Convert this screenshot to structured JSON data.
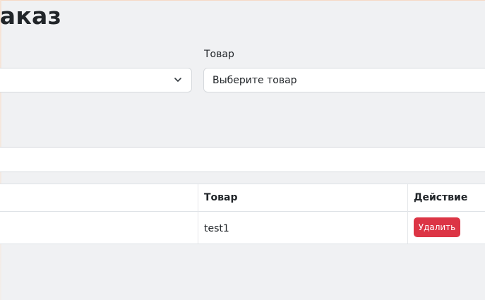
{
  "header": {
    "title": "Заказ"
  },
  "form": {
    "left_select": {
      "value": ""
    },
    "product": {
      "label": "Товар",
      "value": "Выберите товар"
    }
  },
  "table": {
    "columns": [
      "",
      "Товар",
      "Действие"
    ],
    "rows": [
      {
        "product": "test1",
        "action_label": "Удалить"
      }
    ]
  },
  "colors": {
    "background": "#f0f1f3",
    "danger": "#dc3545",
    "border": "#d6d9dd"
  },
  "icons": {
    "select_arrow": "chevron-down-icon"
  }
}
